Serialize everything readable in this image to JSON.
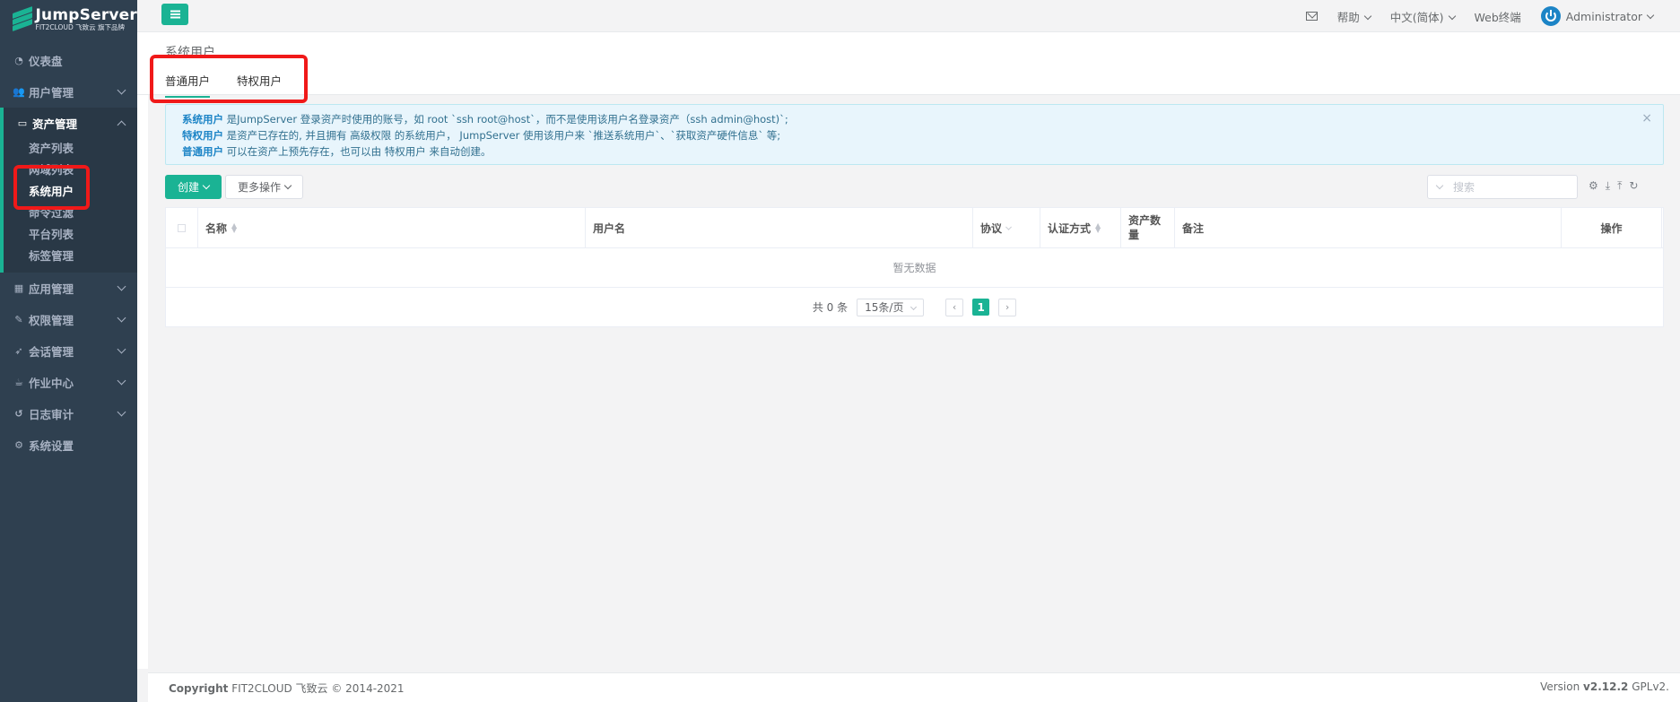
{
  "brand": {
    "title": "JumpServer",
    "subtitle": "FIT2CLOUD 飞致云 旗下品牌"
  },
  "sidebar": {
    "items": [
      {
        "label": "仪表盘",
        "icon": "dashboard-icon"
      },
      {
        "label": "用户管理",
        "icon": "users-icon"
      },
      {
        "label": "资产管理",
        "icon": "inbox-icon"
      },
      {
        "label": "应用管理",
        "icon": "grid-icon"
      },
      {
        "label": "权限管理",
        "icon": "edit-icon"
      },
      {
        "label": "会话管理",
        "icon": "rocket-icon"
      },
      {
        "label": "作业中心",
        "icon": "coffee-icon"
      },
      {
        "label": "日志审计",
        "icon": "history-icon"
      },
      {
        "label": "系统设置",
        "icon": "gears-icon"
      }
    ],
    "asset_sub": [
      "资产列表",
      "网域列表",
      "系统用户",
      "命令过滤",
      "平台列表",
      "标签管理"
    ]
  },
  "header": {
    "help": "帮助",
    "language": "中文(简体)",
    "web_terminal": "Web终端",
    "user": "Administrator"
  },
  "page": {
    "title": "系统用户",
    "tabs": [
      "普通用户",
      "特权用户"
    ]
  },
  "alert": {
    "line1_bold": "系统用户",
    "line1": "是JumpServer 登录资产时使用的账号，如 root `ssh root@host`，而不是使用该用户名登录资产（ssh admin@host)`;",
    "line2_bold": "特权用户",
    "line2": "是资产已存在的, 并且拥有 高级权限 的系统用户， JumpServer 使用该用户来 `推送系统用户`、`获取资产硬件信息` 等;",
    "line3_bold": "普通用户",
    "line3": "可以在资产上预先存在，也可以由 特权用户 来自动创建。"
  },
  "toolbar": {
    "create": "创建",
    "more": "更多操作",
    "search_placeholder": "搜索"
  },
  "table": {
    "columns": [
      "名称",
      "用户名",
      "协议",
      "认证方式",
      "资产数量",
      "备注",
      "操作"
    ],
    "empty": "暂无数据"
  },
  "pager": {
    "total": "共 0 条",
    "size": "15条/页",
    "page": "1"
  },
  "footer": {
    "copyright_bold": "Copyright",
    "copyright": "FIT2CLOUD 飞致云 © 2014-2021",
    "version_label": "Version",
    "version": "v2.12.2",
    "license": "GPLv2."
  },
  "colors": {
    "primary": "#1ab394",
    "sidebar": "#2f4050",
    "annotation": "#f01919"
  }
}
